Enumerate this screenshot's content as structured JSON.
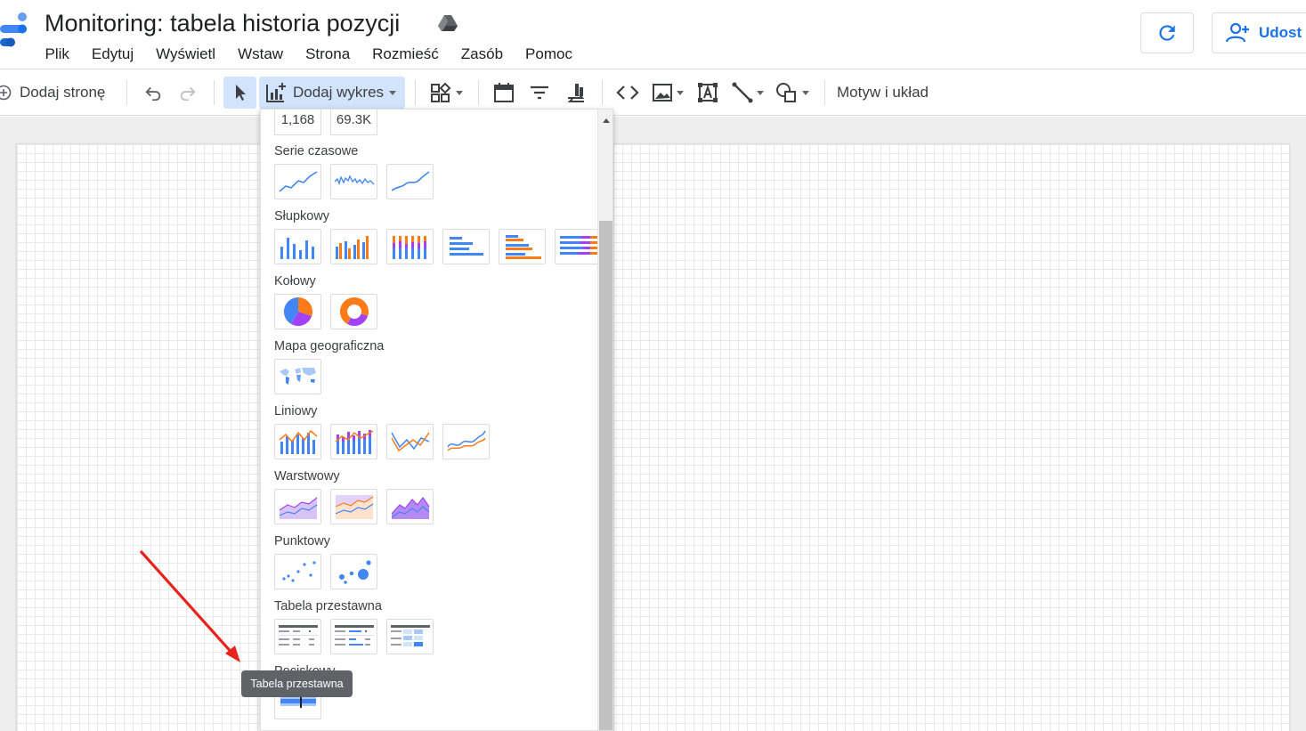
{
  "header": {
    "title": "Monitoring: tabela historia pozycji",
    "menu": [
      "Plik",
      "Edytuj",
      "Wyświetl",
      "Wstaw",
      "Strona",
      "Rozmieść",
      "Zasób",
      "Pomoc"
    ],
    "share_label": "Udost",
    "accent_color": "#1a73e8"
  },
  "toolbar": {
    "add_page_label": "Dodaj stronę",
    "add_chart_label": "Dodaj wykres",
    "theme_label": "Motyw i układ"
  },
  "chart_menu": {
    "kpi_values": [
      "1,168",
      "69.3K"
    ],
    "sections": {
      "time_series": "Serie czasowe",
      "bar": "Słupkowy",
      "pie": "Kołowy",
      "geo": "Mapa geograficzna",
      "line": "Liniowy",
      "area": "Warstwowy",
      "scatter": "Punktowy",
      "pivot": "Tabela przestawna",
      "bullet": "Pociskowy"
    },
    "tooltip": "Tabela przestawna"
  },
  "colors": {
    "blue": "#4285f4",
    "orange": "#fa7b17",
    "purple": "#a142f4",
    "annotation_red": "#e8231c"
  },
  "icons": [
    "logo-icon",
    "drive-icon",
    "refresh-icon",
    "add-person-icon",
    "add-page-icon",
    "undo-icon",
    "redo-icon",
    "select-icon",
    "add-chart-icon",
    "add-control-icon",
    "date-range-icon",
    "filter-icon",
    "data-control-icon",
    "embed-icon",
    "image-icon",
    "text-icon",
    "line-icon",
    "shape-icon"
  ]
}
